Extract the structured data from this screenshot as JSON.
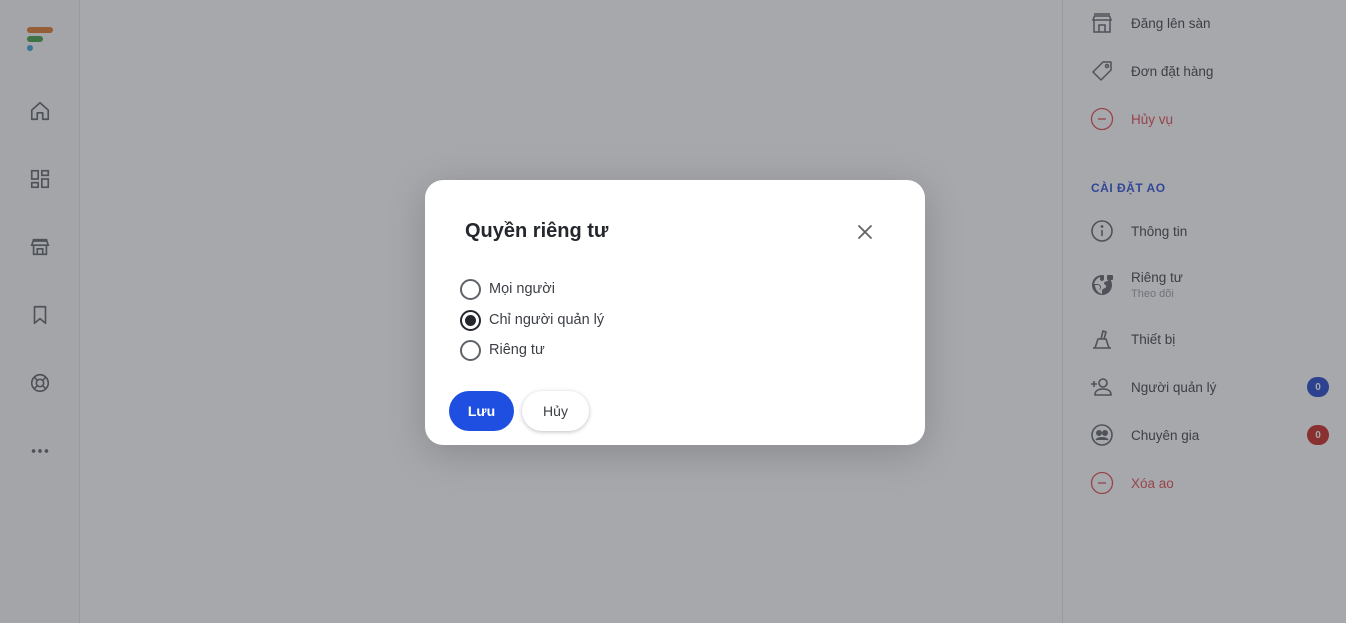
{
  "brand": {
    "colors": [
      "#e0782a",
      "#3f9e44",
      "#3aa0d8"
    ]
  },
  "rail": {
    "items": [
      {
        "icon": "home-icon"
      },
      {
        "icon": "dashboard-icon"
      },
      {
        "icon": "store-icon"
      },
      {
        "icon": "bookmark-icon"
      },
      {
        "icon": "support-icon"
      },
      {
        "icon": "more-icon"
      }
    ]
  },
  "right_panel": {
    "items_top": [
      {
        "label": "Đăng lên sàn",
        "icon": "store-icon"
      },
      {
        "label": "Đơn đặt hàng",
        "icon": "tag-icon"
      },
      {
        "label": "Hủy vụ",
        "icon": "minus-circle-icon"
      }
    ],
    "section_title": "CÀI ĐẶT AO",
    "items": [
      {
        "label": "Thông tin",
        "icon": "info-icon"
      },
      {
        "label": "Riêng tư",
        "sublabel": "Theo dõi",
        "icon": "globe-lock-icon"
      },
      {
        "label": "Thiết bị",
        "icon": "device-icon"
      },
      {
        "label": "Người quản lý",
        "icon": "add-person-icon",
        "badge": "0",
        "badge_color": "#1f45c8"
      },
      {
        "label": "Chuyên gia",
        "icon": "expert-icon",
        "badge": "0",
        "badge_color": "#c8251f"
      },
      {
        "label": "Xóa ao",
        "icon": "minus-circle-icon"
      }
    ]
  },
  "modal": {
    "title": "Quyền riêng tư",
    "options": [
      {
        "label": "Mọi người",
        "checked": false
      },
      {
        "label": "Chỉ người quản lý",
        "checked": true
      },
      {
        "label": "Riêng tư",
        "checked": false
      }
    ],
    "save_label": "Lưu",
    "cancel_label": "Hủy",
    "accent": "#1f4fe0"
  }
}
